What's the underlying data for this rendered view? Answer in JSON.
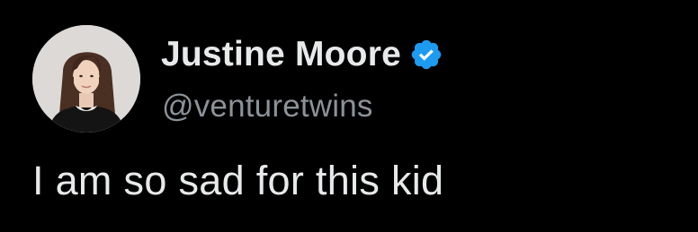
{
  "tweet": {
    "author": {
      "display_name": "Justine Moore",
      "handle": "@venturetwins",
      "verified": true,
      "verified_icon": "verified-badge-icon",
      "avatar_icon": "avatar-photo"
    },
    "text": "I am so sad for this kid"
  },
  "colors": {
    "background": "#000000",
    "primary_text": "#e7e9ea",
    "secondary_text": "#8b9298",
    "verified_badge": "#1d9bf0"
  }
}
